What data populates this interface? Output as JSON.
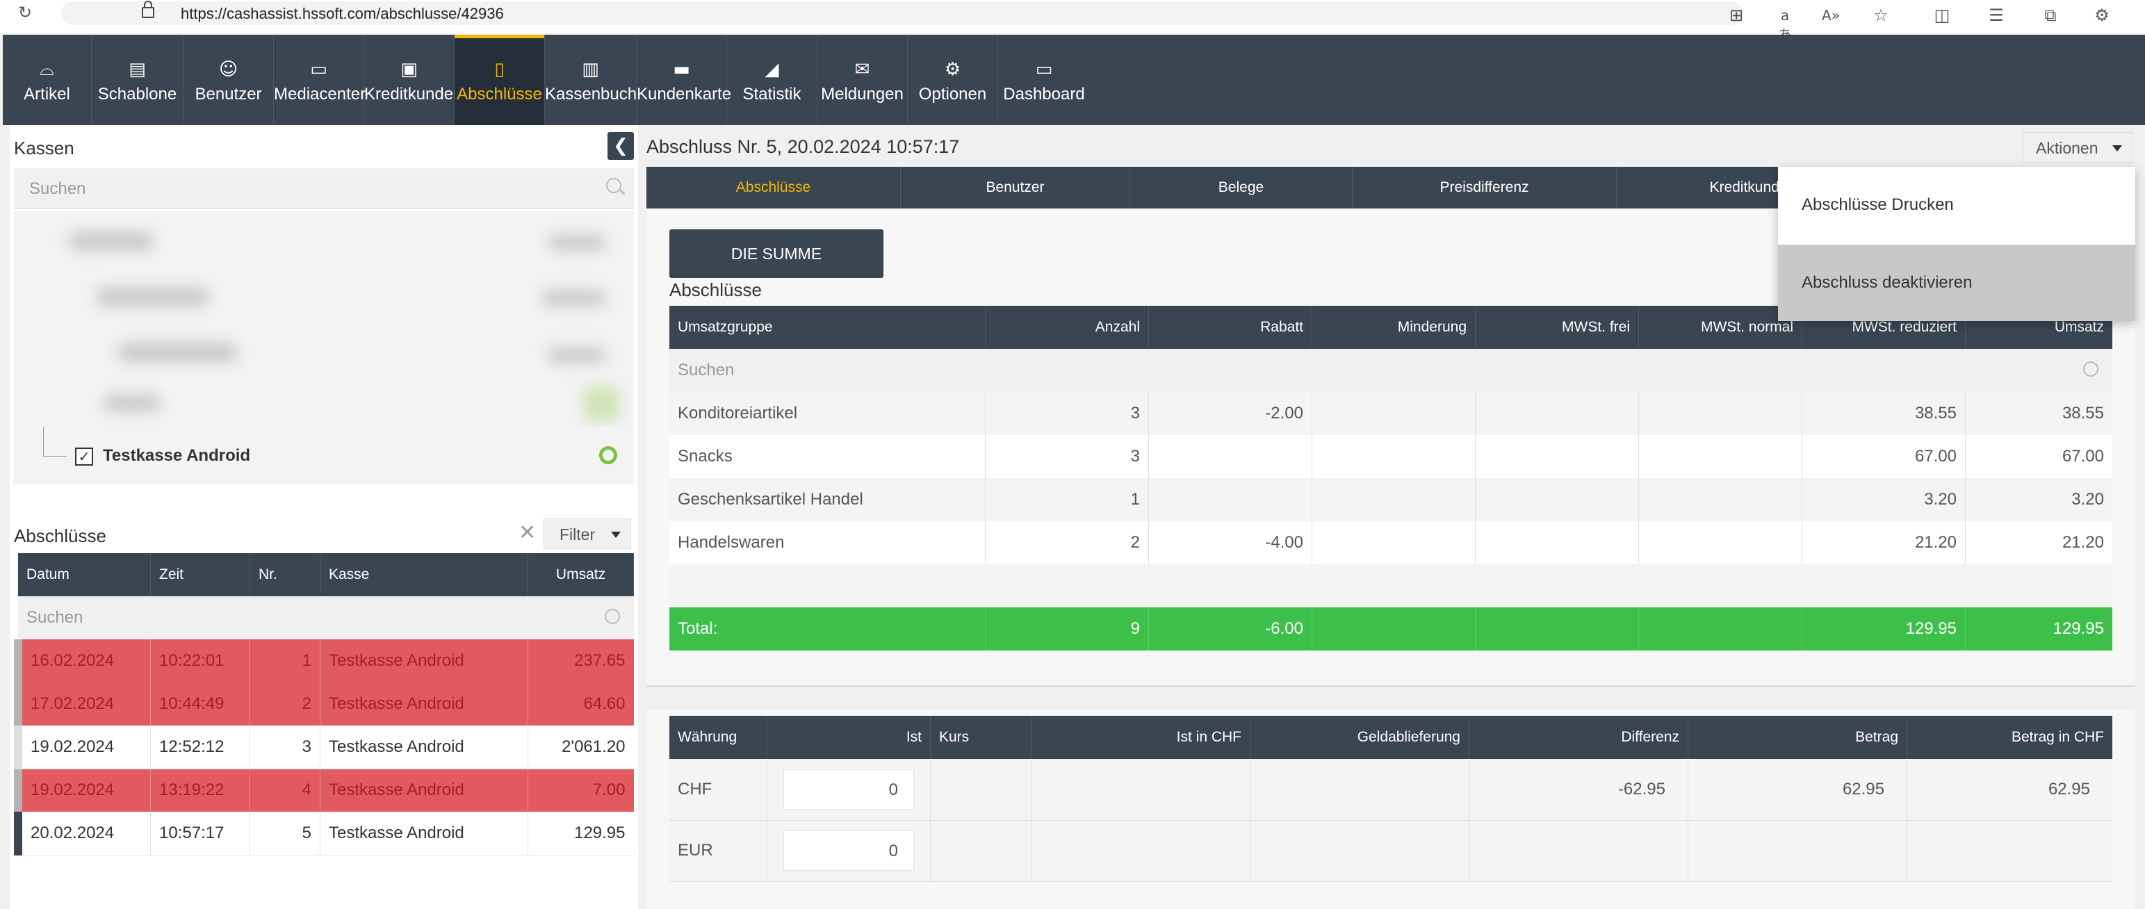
{
  "browser": {
    "url": "https://cashassist.hssoft.com/abschlusse/42936"
  },
  "nav": {
    "items": [
      {
        "label": "Artikel",
        "icon": "bread-icon"
      },
      {
        "label": "Schablone",
        "icon": "template-icon"
      },
      {
        "label": "Benutzer",
        "icon": "users-icon"
      },
      {
        "label": "Mediacenter",
        "icon": "monitor-icon"
      },
      {
        "label": "Kreditkunden",
        "icon": "id-card-icon"
      },
      {
        "label": "Abschlüsse",
        "icon": "document-icon",
        "active": true
      },
      {
        "label": "Kassenbuch",
        "icon": "book-icon"
      },
      {
        "label": "Kundenkarte",
        "icon": "card-icon"
      },
      {
        "label": "Statistik",
        "icon": "chart-icon"
      },
      {
        "label": "Meldungen",
        "icon": "mail-icon"
      },
      {
        "label": "Optionen",
        "icon": "gear-icon"
      },
      {
        "label": "Dashboard",
        "icon": "dashboard-icon"
      }
    ]
  },
  "left": {
    "kassen_title": "Kassen",
    "search_placeholder": "Suchen",
    "tree_item": "Testkasse Android",
    "abschluesse_title": "Abschlüsse",
    "filter_label": "Filter",
    "table": {
      "headers": [
        "Datum",
        "Zeit",
        "Nr.",
        "Kasse",
        "Umsatz"
      ],
      "search_placeholder": "Suchen",
      "rows": [
        {
          "datum": "16.02.2024",
          "zeit": "10:22:01",
          "nr": "1",
          "kasse": "Testkasse Android",
          "umsatz": "237.65",
          "status": "red"
        },
        {
          "datum": "17.02.2024",
          "zeit": "10:44:49",
          "nr": "2",
          "kasse": "Testkasse Android",
          "umsatz": "64.60",
          "status": "red"
        },
        {
          "datum": "19.02.2024",
          "zeit": "12:52:12",
          "nr": "3",
          "kasse": "Testkasse Android",
          "umsatz": "2'061.20",
          "status": "normal"
        },
        {
          "datum": "19.02.2024",
          "zeit": "13:19:22",
          "nr": "4",
          "kasse": "Testkasse Android",
          "umsatz": "7.00",
          "status": "red"
        },
        {
          "datum": "20.02.2024",
          "zeit": "10:57:17",
          "nr": "5",
          "kasse": "Testkasse Android",
          "umsatz": "129.95",
          "status": "selected"
        }
      ]
    }
  },
  "main": {
    "header": "Abschluss Nr. 5, 20.02.2024 10:57:17",
    "aktionen_label": "Aktionen",
    "tabs": [
      "Abschlüsse",
      "Benutzer",
      "Belege",
      "Preisdifferenz",
      "Kreditkunde"
    ],
    "summe_button": "DIE SUMME",
    "section_title": "Abschlüsse",
    "dropdown": [
      "Abschlüsse Drucken",
      "Abschluss deaktivieren"
    ],
    "table": {
      "headers": [
        "Umsatzgruppe",
        "Anzahl",
        "Rabatt",
        "Minderung",
        "MWSt. frei",
        "MWSt. normal",
        "MWSt. reduziert",
        "Umsatz"
      ],
      "search_placeholder": "Suchen",
      "rows": [
        [
          "Konditoreiartikel",
          "3",
          "-2.00",
          "",
          "",
          "",
          "38.55",
          "38.55"
        ],
        [
          "Snacks",
          "3",
          "",
          "",
          "",
          "",
          "67.00",
          "67.00"
        ],
        [
          "Geschenksartikel Handel",
          "1",
          "",
          "",
          "",
          "",
          "3.20",
          "3.20"
        ],
        [
          "Handelswaren",
          "2",
          "-4.00",
          "",
          "",
          "",
          "21.20",
          "21.20"
        ]
      ],
      "total": [
        "Total:",
        "9",
        "-6.00",
        "",
        "",
        "",
        "129.95",
        "129.95"
      ]
    },
    "currency": {
      "headers": [
        "Währung",
        "Ist",
        "Kurs",
        "Ist in CHF",
        "Geldablieferung",
        "Differenz",
        "Betrag",
        "Betrag in CHF"
      ],
      "rows": [
        {
          "waehrung": "CHF",
          "ist": "0",
          "kurs": "",
          "ist_chf": "",
          "geld": "",
          "differenz": "-62.95",
          "betrag": "62.95",
          "betrag_chf": "62.95"
        },
        {
          "waehrung": "EUR",
          "ist": "0",
          "kurs": "",
          "ist_chf": "",
          "geld": "",
          "differenz": "",
          "betrag": "",
          "betrag_chf": ""
        }
      ]
    }
  },
  "colors": {
    "nav_bg": "#3a4552",
    "accent": "#f5b800",
    "row_red": "#e05a5f",
    "total_green": "#3cc04a"
  }
}
